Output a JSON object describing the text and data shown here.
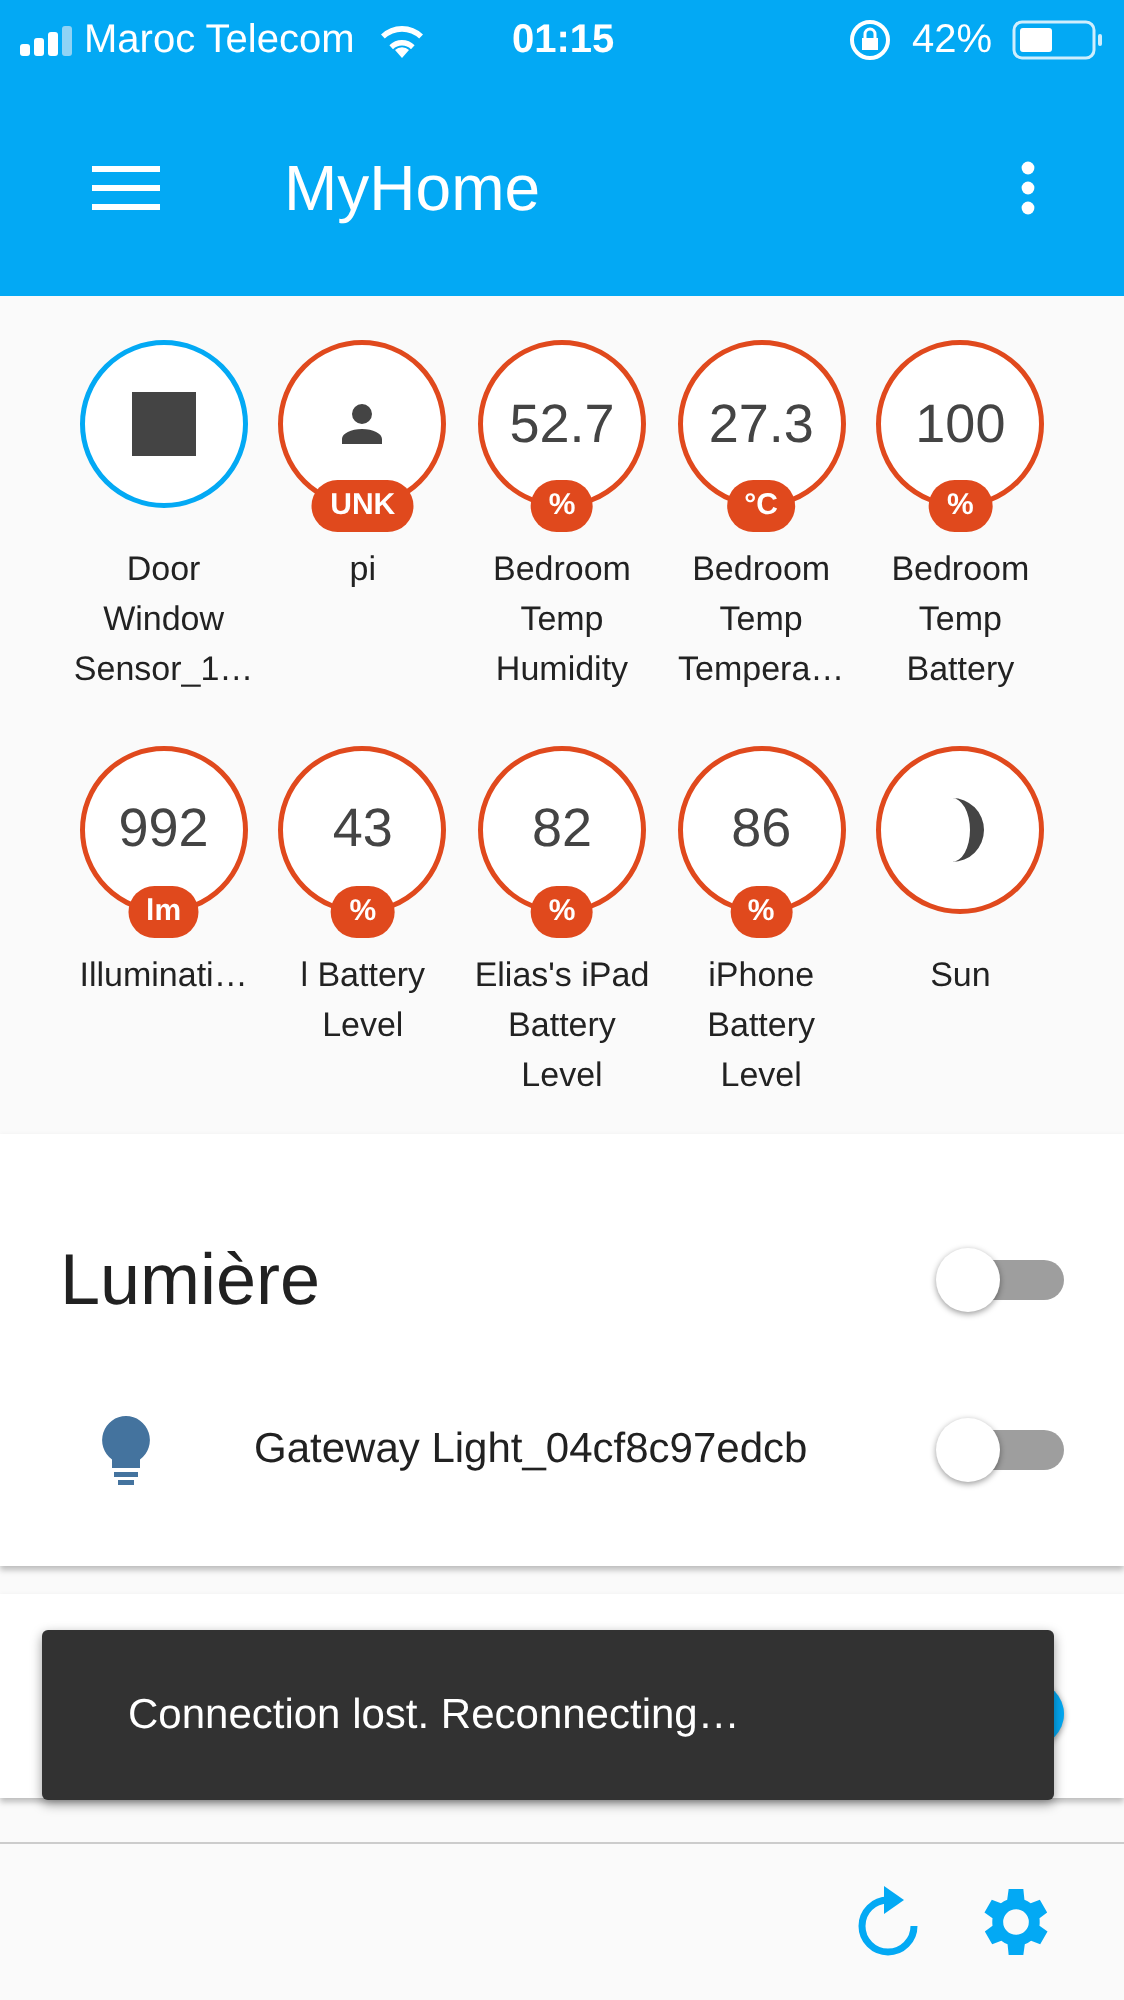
{
  "status_bar": {
    "carrier": "Maroc Telecom",
    "time": "01:15",
    "battery": "42%"
  },
  "app_bar": {
    "title": "MyHome"
  },
  "badges": [
    {
      "kind": "square",
      "label": "Door Window Sensor_1…",
      "color": "#03a9f4"
    },
    {
      "kind": "person",
      "unit": "UNK",
      "label": "pi",
      "color": "#e0491d"
    },
    {
      "kind": "value",
      "value": "52.7",
      "unit": "%",
      "label": "Bedroom Temp Humidity",
      "color": "#e0491d"
    },
    {
      "kind": "value",
      "value": "27.3",
      "unit": "°C",
      "label": "Bedroom Temp Tempera…",
      "color": "#e0491d"
    },
    {
      "kind": "value",
      "value": "100",
      "unit": "%",
      "label": "Bedroom Temp Battery",
      "color": "#e0491d"
    },
    {
      "kind": "value",
      "value": "992",
      "unit": "lm",
      "label": "Illuminati…",
      "color": "#e0491d"
    },
    {
      "kind": "value",
      "value": "43",
      "unit": "%",
      "label": "l Battery Level",
      "color": "#e0491d"
    },
    {
      "kind": "value",
      "value": "82",
      "unit": "%",
      "label": "Elias's iPad Battery Level",
      "color": "#e0491d"
    },
    {
      "kind": "value",
      "value": "86",
      "unit": "%",
      "label": "iPhone Battery Level",
      "color": "#e0491d"
    },
    {
      "kind": "moon",
      "label": "Sun",
      "color": "#e0491d"
    }
  ],
  "cards": [
    {
      "title": "Lumière",
      "on": false,
      "entities": [
        {
          "name": "Gateway Light_04cf8c97edcb",
          "on": false
        }
      ]
    },
    {
      "on": true
    }
  ],
  "toast": {
    "message": "Connection lost. Reconnecting…"
  }
}
